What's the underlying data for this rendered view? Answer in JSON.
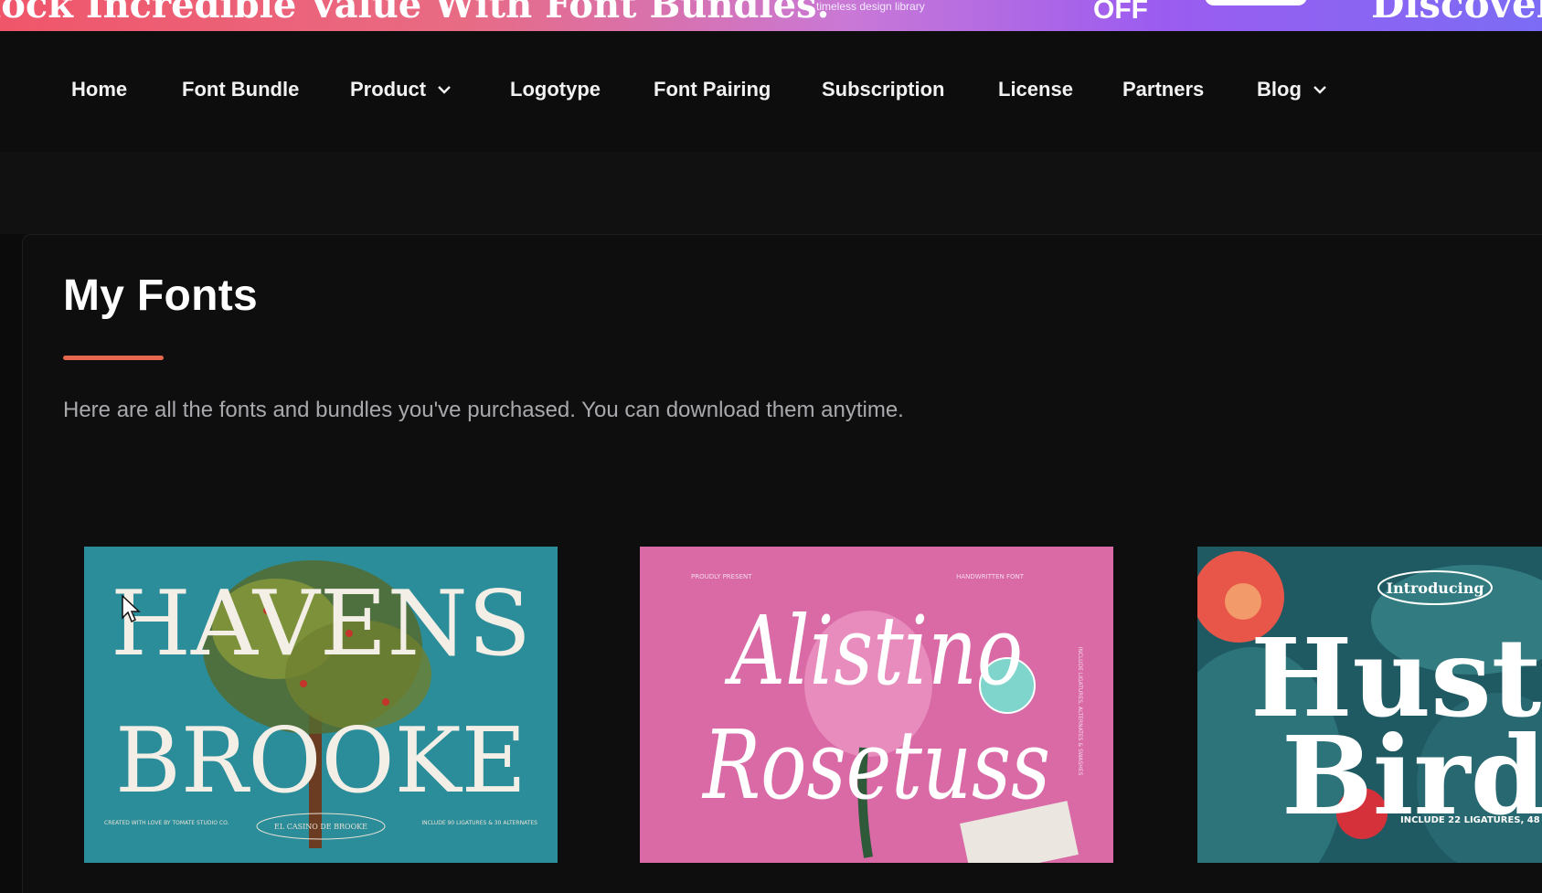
{
  "promo": {
    "headline": "lock Incredible Value With Font Bundles.",
    "tagline": "timeless design library",
    "offer": "OFF",
    "discover": "Discover"
  },
  "nav": {
    "items": [
      {
        "label": "Home"
      },
      {
        "label": "Font Bundle"
      },
      {
        "label": "Product",
        "dropdown": true
      },
      {
        "label": "Logotype"
      },
      {
        "label": "Font Pairing"
      },
      {
        "label": "Subscription"
      },
      {
        "label": "License"
      },
      {
        "label": "Partners"
      },
      {
        "label": "Blog",
        "dropdown": true
      }
    ]
  },
  "page": {
    "title": "My Fonts",
    "description": "Here are all the fonts and bundles you've purchased. You can download them anytime.",
    "accent_color": "#e5674f"
  },
  "cards": [
    {
      "name_line1": "HAVENS",
      "name_line2": "BROOKE",
      "footer_left": "CREATED WITH LOVE BY TOMATE STUDIO CO.",
      "footer_center": "EL CASINO DE BROOKE",
      "footer_right": "INCLUDE 90 LIGATURES & 30 ALTERNATES",
      "bg_color": "#2b8d9a"
    },
    {
      "name_line1": "Alistino",
      "name_line2": "Rosetuss",
      "top_left": "PROUDLY PRESENT",
      "top_right": "HANDWRITTEN FONT",
      "side_text": "INCLUDE LIGATURES, ALTERNATES & SWASHES",
      "bg_color": "#d96aa6"
    },
    {
      "intro": "Introducing",
      "name_line1": "Hust",
      "name_line2": "Bird",
      "footer": "INCLUDE 22 LIGATURES, 48",
      "bg_color": "#1f5a63"
    }
  ]
}
